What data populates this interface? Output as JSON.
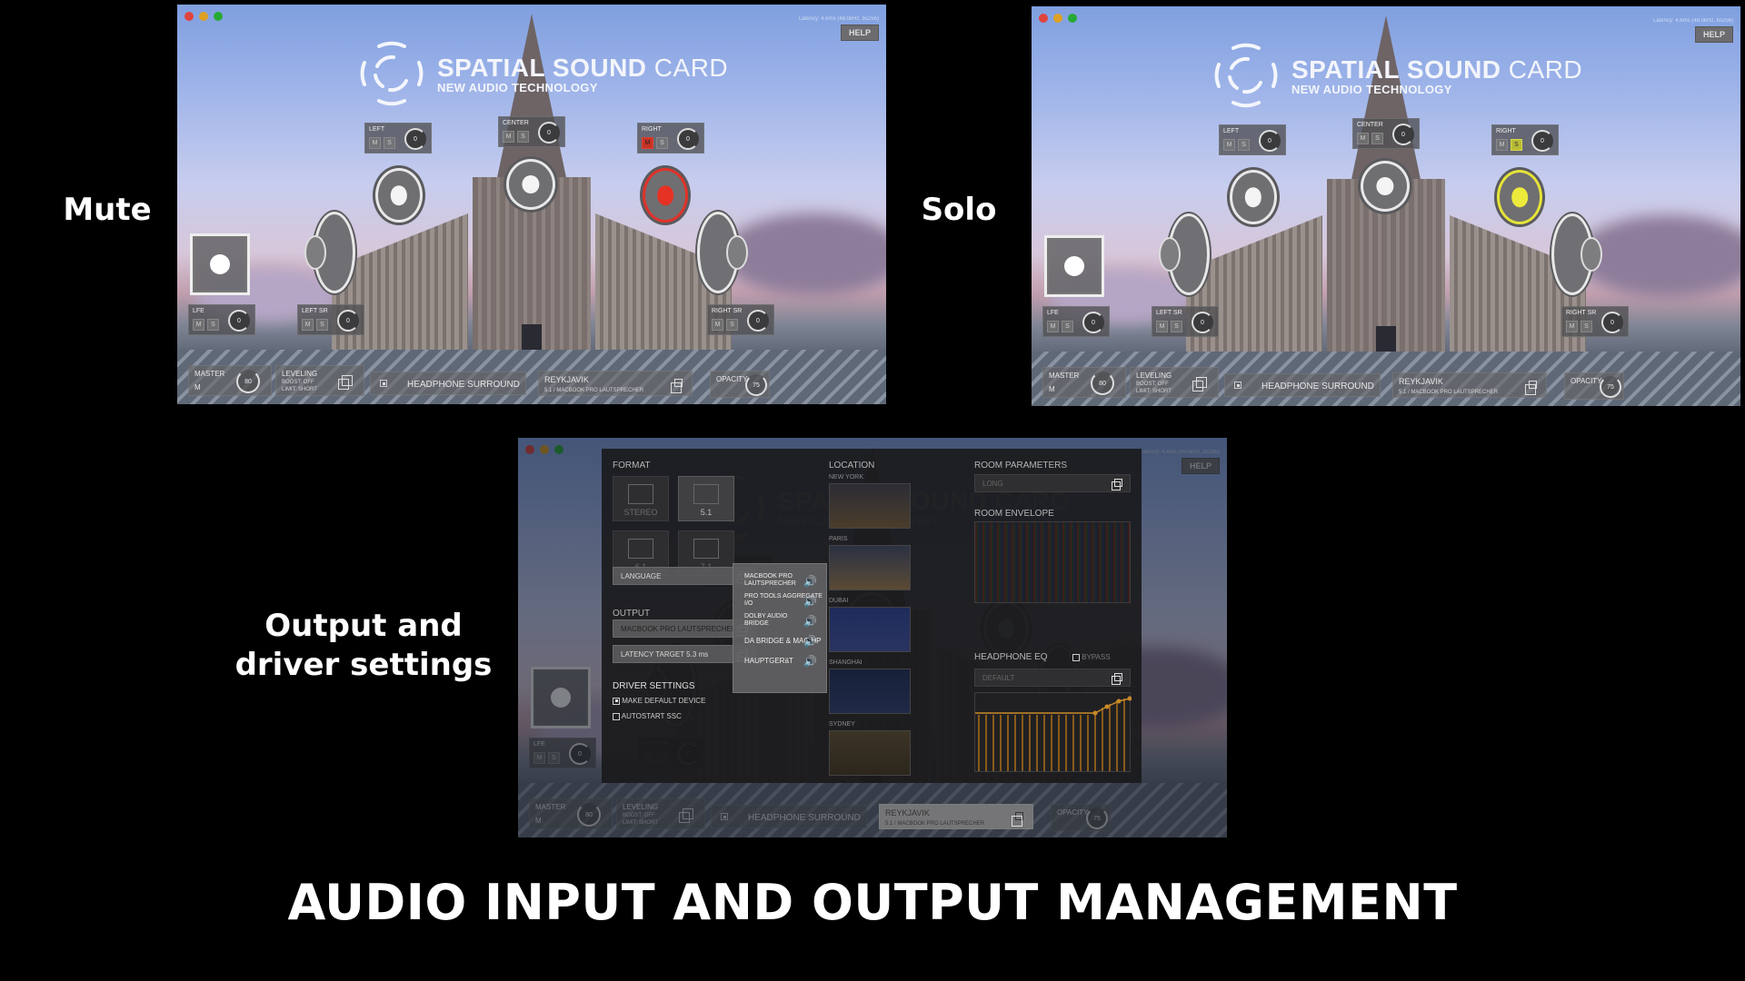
{
  "labels": {
    "mute": "Mute",
    "solo": "Solo",
    "output_line1": "Output and",
    "output_line2": "driver settings",
    "main_title": "AUDIO INPUT AND OUTPUT MANAGEMENT"
  },
  "app": {
    "brand_bold": "SPATIAL SOUND",
    "brand_light": "CARD",
    "brand_sub": "NEW AUDIO TECHNOLOGY",
    "latency_readout": "Latency: 4.6ms (48.0kHz, bs256)",
    "help": "HELP",
    "traffic_colors": [
      "#e0443e",
      "#dea123",
      "#27aa35"
    ]
  },
  "channels": {
    "left": "LEFT",
    "center": "CENTER",
    "right": "RIGHT",
    "lfe": "LFE",
    "left_sr": "LEFT SR",
    "right_sr": "RIGHT SR",
    "mute_btn": "M",
    "solo_btn": "S",
    "gain": "0"
  },
  "bottom_bar": {
    "master_label": "MASTER",
    "master_btn": "M",
    "master_value": "80",
    "leveling_label": "LEVELING",
    "leveling_boost": "BOOST: OFF",
    "leveling_limit": "LIMIT: SHORT",
    "headphone_surround": "HEADPHONE SURROUND",
    "location_name": "REYKJAVIK",
    "location_detail": "5.1 / MACBOOK PRO LAUTSPRECHER",
    "opacity_label": "OPACITY",
    "opacity_value": "75"
  },
  "states": {
    "mute_window": {
      "right_channel": "muted"
    },
    "solo_window": {
      "right_channel": "solo"
    }
  },
  "settings": {
    "format_label": "FORMAT",
    "formats": [
      {
        "label": "STEREO",
        "selected": false
      },
      {
        "label": "5.1",
        "selected": true
      },
      {
        "label": "6.1",
        "selected": false
      },
      {
        "label": "7.1",
        "selected": false
      }
    ],
    "location_label": "LOCATION",
    "locations": [
      "NEW YORK",
      "PARIS",
      "DUBAI",
      "SHANGHAI",
      "SYDNEY"
    ],
    "language_label": "LANGUAGE",
    "output_label": "OUTPUT",
    "output_value": "MACBOOK PRO LAUTSPRECHER",
    "latency_target": "LATENCY TARGET 5.3 ms",
    "driver_settings_label": "DRIVER SETTINGS",
    "make_default_device": "MAKE DEFAULT DEVICE",
    "make_default_checked": true,
    "autostart": "AUTOSTART SSC",
    "autostart_checked": false,
    "room_parameters_label": "ROOM PARAMETERS",
    "room_parameters_value": "LONG",
    "room_envelope_label": "ROOM ENVELOPE",
    "headphone_eq_label": "HEADPHONE EQ",
    "bypass_label": "BYPASS",
    "bypass_checked": false,
    "eq_preset": "DEFAULT",
    "output_devices": [
      {
        "line1": "MACBOOK PRO",
        "line2": "LAUTSPRECHER"
      },
      {
        "line1": "PRO TOOLS AGGREGATE",
        "line2": "I/O"
      },
      {
        "line1": "DOLBY AUDIO",
        "line2": "BRIDGE"
      },
      {
        "line1": "DA BRIDGE & MAC HP",
        "line2": ""
      },
      {
        "line1": "HAUPTGERäT",
        "line2": ""
      }
    ]
  }
}
